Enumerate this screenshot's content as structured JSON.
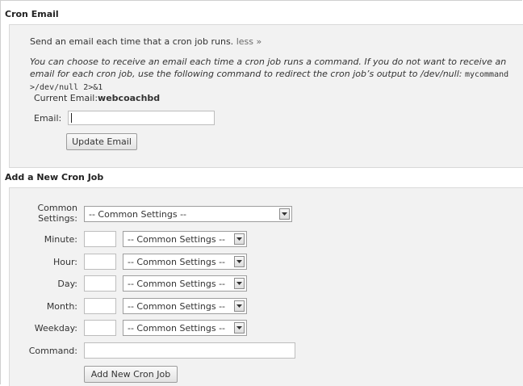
{
  "cron_email": {
    "title": "Cron Email",
    "intro": "Send an email each time that a cron job runs.",
    "less_link": "less »",
    "description": "You can choose to receive an email each time a cron job runs a command. If you do not want to receive an email for each cron job, use the following command to redirect the cron job’s output to /dev/null:",
    "command_example": "mycommand >/dev/null 2>&1",
    "current_email_label": "Current Email:",
    "current_email_value": "webcoachbd",
    "email_label": "Email:",
    "email_value": "",
    "update_button": "Update Email"
  },
  "new_cron": {
    "title": "Add a New Cron Job",
    "common_label_line1": "Common",
    "common_label_line2": "Settings:",
    "common_select": "-- Common Settings --",
    "fields": [
      {
        "label": "Minute:",
        "value": "",
        "select": "-- Common Settings --"
      },
      {
        "label": "Hour:",
        "value": "",
        "select": "-- Common Settings --"
      },
      {
        "label": "Day:",
        "value": "",
        "select": "-- Common Settings --"
      },
      {
        "label": "Month:",
        "value": "",
        "select": "-- Common Settings --"
      },
      {
        "label": "Weekday:",
        "value": "",
        "select": "-- Common Settings --"
      }
    ],
    "command_label": "Command:",
    "command_value": "",
    "add_button": "Add New Cron Job"
  }
}
